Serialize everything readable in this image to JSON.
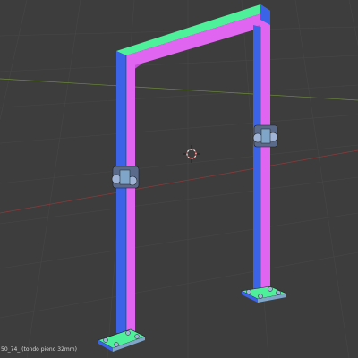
{
  "viewport": {
    "background": "#3d3d3d",
    "grid_color": "#474747",
    "axis_x_color": "#8a3a3a",
    "axis_y_color": "#6d8a3a",
    "status_text": "50_74_ (tondo pieno 32mm)",
    "cursor_icon": "3d-cursor-icon"
  },
  "model": {
    "name": "gantry-frame",
    "face_colors": {
      "front": "#e066f2",
      "side": "#3a63e8",
      "top": "#4ff09a",
      "hardware": "#7fa6c9"
    }
  }
}
